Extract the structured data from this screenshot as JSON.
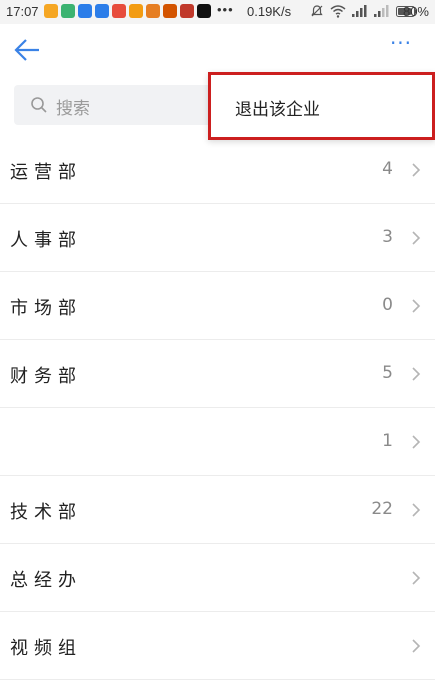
{
  "status_bar": {
    "time": "17:07",
    "apps": [
      {
        "name": "app-icon-1",
        "color": "#f5a623"
      },
      {
        "name": "app-icon-2",
        "color": "#3cb371"
      },
      {
        "name": "app-icon-3",
        "color": "#2b7de9"
      },
      {
        "name": "app-icon-4",
        "color": "#2b7de9"
      },
      {
        "name": "app-icon-5",
        "color": "#e74c3c"
      },
      {
        "name": "app-icon-6",
        "color": "#f39c12"
      },
      {
        "name": "app-icon-7",
        "color": "#e67e22"
      },
      {
        "name": "app-icon-8",
        "color": "#d35400"
      },
      {
        "name": "app-icon-9",
        "color": "#c0392b"
      },
      {
        "name": "app-icon-10",
        "color": "#111111"
      }
    ],
    "more": "•••",
    "net_speed": "0.19K/s",
    "battery": "80%"
  },
  "header": {
    "more_label": "···"
  },
  "search": {
    "placeholder": "搜索"
  },
  "popup": {
    "item": "退出该企业"
  },
  "departments": [
    {
      "name": "运营部",
      "count": "4"
    },
    {
      "name": "人事部",
      "count": "3"
    },
    {
      "name": "市场部",
      "count": "0"
    },
    {
      "name": "财务部",
      "count": "5"
    },
    {
      "name": "",
      "count": "1"
    },
    {
      "name": "技术部",
      "count": "22"
    },
    {
      "name": "总经办",
      "count": ""
    },
    {
      "name": "视频组",
      "count": ""
    }
  ],
  "colors": {
    "accent": "#3a82e6",
    "popup_border": "#cc1f1f"
  }
}
